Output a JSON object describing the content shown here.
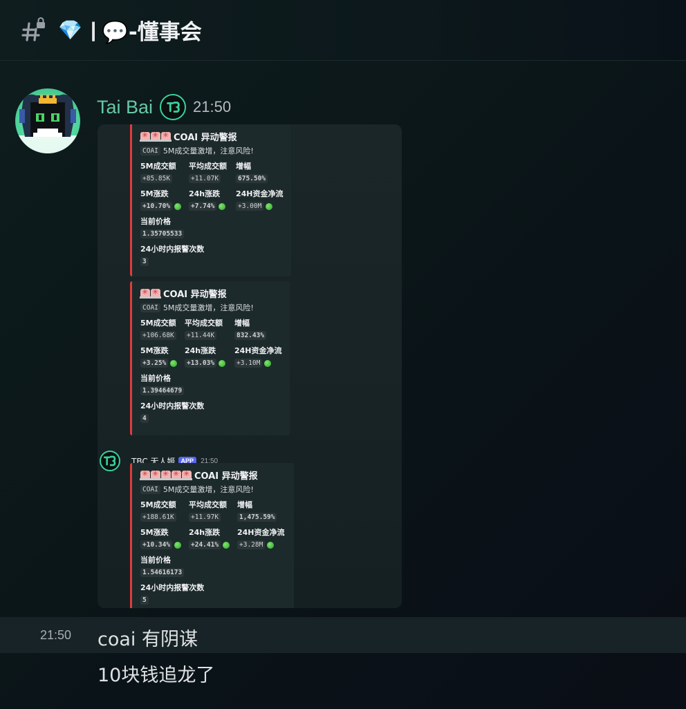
{
  "header": {
    "channel_icon": "hash-lock-icon",
    "gem_emoji": "💎",
    "separator": "|",
    "title": "💬-懂事会"
  },
  "message": {
    "username": "Tai Bai",
    "badge_icon": "tbc-badge-icon",
    "time": "21:50"
  },
  "embeds": [
    {
      "sirens": 3,
      "title": "COAI 异动警报",
      "desc_code": "COAI",
      "desc_text": "5M成交量激增，注意风险!",
      "row1": [
        {
          "name": "5M成交额",
          "value": "+85.85K",
          "dot": false
        },
        {
          "name": "平均成交额",
          "value": "+11.07K",
          "dot": false
        },
        {
          "name": "增幅",
          "value": "675.50%",
          "dot": false
        }
      ],
      "row2": [
        {
          "name": "5M涨跌",
          "value": "+10.70%",
          "dot": true
        },
        {
          "name": "24h涨跌",
          "value": "+7.74%",
          "dot": true
        },
        {
          "name": "24H资金净流",
          "value": "+3.00M",
          "dot": true
        }
      ],
      "price_label": "当前价格",
      "price": "1.35705533",
      "count_label": "24小时内报警次数",
      "count": "3"
    },
    {
      "sirens": 2,
      "title": "COAI 异动警报",
      "desc_code": "COAI",
      "desc_text": "5M成交量激增，注意风险!",
      "row1": [
        {
          "name": "5M成交额",
          "value": "+106.68K",
          "dot": false
        },
        {
          "name": "平均成交额",
          "value": "+11.44K",
          "dot": false
        },
        {
          "name": "增幅",
          "value": "832.43%",
          "dot": false
        }
      ],
      "row2": [
        {
          "name": "5M涨跌",
          "value": "+3.25%",
          "dot": true
        },
        {
          "name": "24h涨跌",
          "value": "+13.03%",
          "dot": true
        },
        {
          "name": "24H资金净流",
          "value": "+3.10M",
          "dot": true
        }
      ],
      "price_label": "当前价格",
      "price": "1.39464679",
      "count_label": "24小时内报警次数",
      "count": "4"
    },
    {
      "sirens": 5,
      "title": "COAI 异动警报",
      "desc_code": "COAI",
      "desc_text": "5M成交量激增，注意风险!",
      "row1": [
        {
          "name": "5M成交额",
          "value": "+188.61K",
          "dot": false
        },
        {
          "name": "平均成交额",
          "value": "+11.97K",
          "dot": false
        },
        {
          "name": "增幅",
          "value": "1,475.59%",
          "dot": false
        }
      ],
      "row2": [
        {
          "name": "5M涨跌",
          "value": "+10.34%",
          "dot": true
        },
        {
          "name": "24h涨跌",
          "value": "+24.41%",
          "dot": true
        },
        {
          "name": "24H资金净流",
          "value": "+3.28M",
          "dot": true
        }
      ],
      "price_label": "当前价格",
      "price": "1.54616173",
      "count_label": "24小时内报警次数",
      "count": "5"
    }
  ],
  "bot": {
    "name": "TBC 无人姬",
    "app_badge": "APP",
    "time": "21:50"
  },
  "followups": [
    {
      "time": "21:50",
      "text": "coai 有阴谋"
    },
    {
      "time": "",
      "text": "10块钱追龙了"
    }
  ]
}
